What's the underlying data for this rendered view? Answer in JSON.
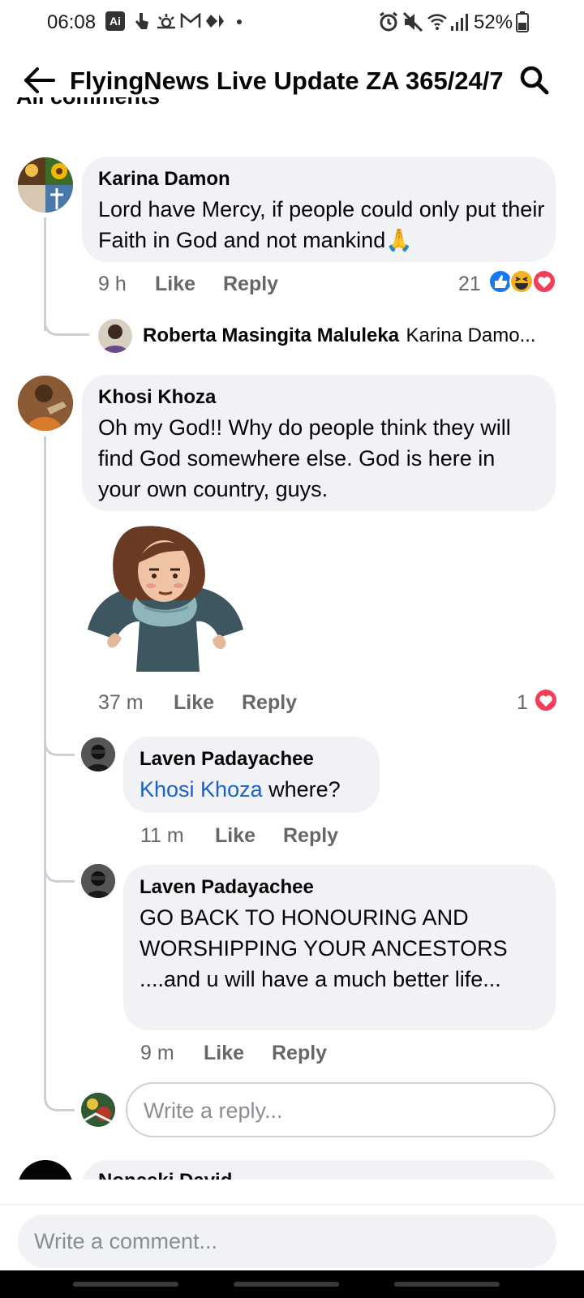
{
  "status_bar": {
    "time": "06:08",
    "battery": "52%"
  },
  "header": {
    "title": "FlyingNews Live Update ZA 365/24/7"
  },
  "section_label": "All comments",
  "comments": [
    {
      "author": "Karina Damon",
      "text": "Lord have Mercy, if people could only put their Faith in God and not mankind",
      "emoji": "🙏",
      "time": "9 h",
      "like": "Like",
      "reply": "Reply",
      "reaction_count": "21"
    },
    {
      "author": "Khosi Khoza",
      "text": "Oh my God!! Why do people think they will find God somewhere else. God is here in your own country, guys.",
      "time": "37 m",
      "like": "Like",
      "reply": "Reply",
      "reaction_count": "1"
    }
  ],
  "collapsed_reply": {
    "author": "Roberta Masingita Maluleka",
    "preview": "Karina Damo..."
  },
  "replies": [
    {
      "author": "Laven Padayachee",
      "mention": "Khosi Khoza",
      "text": " where?",
      "time": "11 m",
      "like": "Like",
      "reply": "Reply"
    },
    {
      "author": "Laven Padayachee",
      "text": "GO BACK TO HONOURING AND WORSHIPPING YOUR ANCESTORS ....and u will have a much better life...",
      "time": "9 m",
      "like": "Like",
      "reply": "Reply"
    }
  ],
  "reply_input": {
    "placeholder": "Write a reply..."
  },
  "next_comment": {
    "author": "Nonceki David"
  },
  "comment_input": {
    "placeholder": "Write a comment..."
  },
  "colors": {
    "bubble": "#f0f2f5",
    "link": "#1a61c7",
    "meta": "#65676b",
    "like_blue": "#1877f2",
    "love_red": "#f33e58"
  }
}
